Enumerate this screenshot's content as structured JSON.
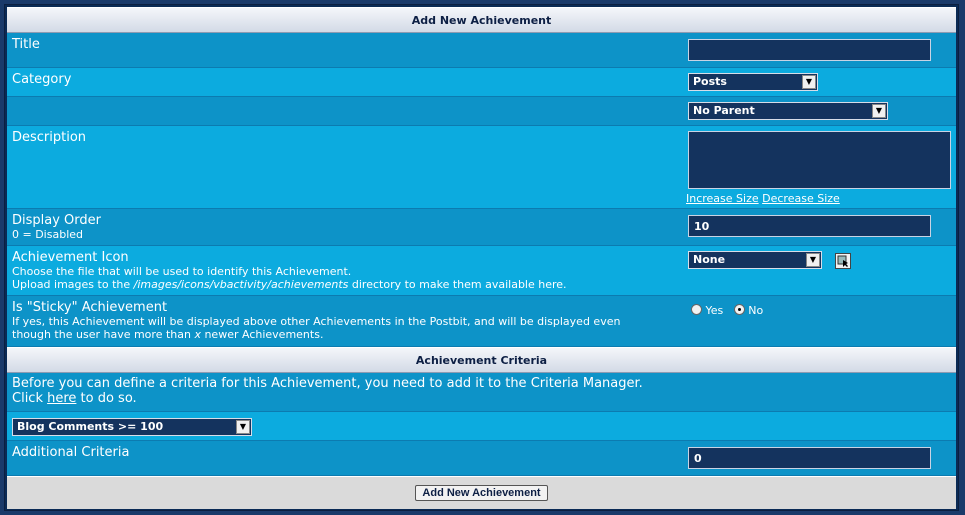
{
  "header": {
    "title": "Add New Achievement"
  },
  "fields": {
    "title": {
      "label": "Title",
      "value": ""
    },
    "category": {
      "label": "Category",
      "value": "Posts"
    },
    "parent": {
      "value": "No Parent"
    },
    "description": {
      "label": "Description",
      "value": "",
      "increase": "Increase Size",
      "decrease": "Decrease Size"
    },
    "display_order": {
      "label": "Display Order",
      "desc": "0 = Disabled",
      "value": "10"
    },
    "icon": {
      "label": "Achievement Icon",
      "desc1": "Choose the file that will be used to identify this Achievement.",
      "desc2_pre": "Upload images to the ",
      "desc2_path": "/images/icons/vbactivity/achievements",
      "desc2_post": " directory to make them available here.",
      "value": "None"
    },
    "sticky": {
      "label": "Is \"Sticky\" Achievement",
      "desc1": "If yes, this Achievement will be displayed above other Achievements in the Postbit, and will be displayed even",
      "desc2_pre": "though the user have more than ",
      "desc2_x": "x",
      "desc2_post": " newer Achievements.",
      "yes": "Yes",
      "no": "No",
      "selected": "No"
    }
  },
  "criteria": {
    "title": "Achievement Criteria",
    "info1": "Before you can define a criteria for this Achievement, you need to add it to the Criteria Manager.",
    "info2_pre": "Click ",
    "info2_link": "here",
    "info2_post": " to do so.",
    "select_value": "Blog Comments >= 100",
    "additional_label": "Additional Criteria",
    "additional_value": "0"
  },
  "footer": {
    "submit": "Add New Achievement"
  }
}
